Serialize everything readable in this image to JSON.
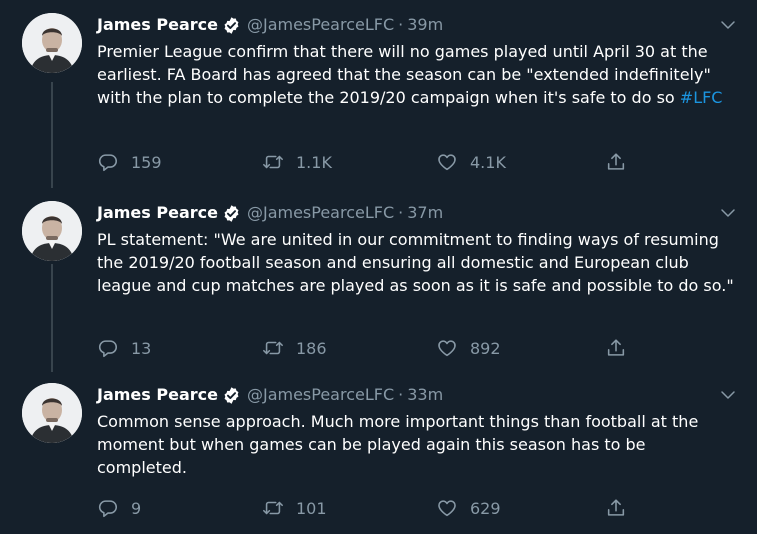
{
  "colors": {
    "background": "#15202b",
    "text": "#ffffff",
    "muted": "#8899a6",
    "link": "#1b95e0",
    "verified": "#ffffff"
  },
  "tweets": [
    {
      "name": "James Pearce",
      "handle": "@JamesPearceLFC",
      "separator": "·",
      "time": "39m",
      "text": "Premier League confirm that there will no games played until April 30 at the earliest. FA Board has agreed that the season can be \"extended indefinitely\" with the plan to complete the 2019/20 campaign when it's safe to do so ",
      "hashtag": "#LFC",
      "replies": "159",
      "retweets": "1.1K",
      "likes": "4.1K"
    },
    {
      "name": "James Pearce",
      "handle": "@JamesPearceLFC",
      "separator": "·",
      "time": "37m",
      "text": "PL statement: \"We are united in our commitment to finding ways of resuming the 2019/20 football season and ensuring all domestic and European club league and cup matches are played as soon as it is safe and possible to do so.\"",
      "hashtag": "",
      "replies": "13",
      "retweets": "186",
      "likes": "892"
    },
    {
      "name": "James Pearce",
      "handle": "@JamesPearceLFC",
      "separator": "·",
      "time": "33m",
      "text": "Common sense approach. Much more important things than football at the moment but when games can be played again this season has to be completed.",
      "hashtag": "",
      "replies": "9",
      "retweets": "101",
      "likes": "629"
    }
  ]
}
